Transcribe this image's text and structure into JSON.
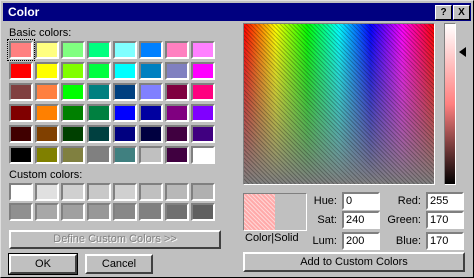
{
  "window": {
    "title": "Color",
    "help_btn": "?",
    "close_btn": "X"
  },
  "labels": {
    "basic_colors": "Basic colors:",
    "basic_colors_key": "B",
    "custom_colors": "Custom colors:",
    "custom_colors_key": "C"
  },
  "basic_colors": [
    "#ff8080",
    "#ffff80",
    "#80ff80",
    "#00ff80",
    "#80ffff",
    "#0080ff",
    "#ff80c0",
    "#ff80ff",
    "#ff0000",
    "#ffff00",
    "#80ff00",
    "#00ff40",
    "#00ffff",
    "#0080c0",
    "#8080c0",
    "#ff00ff",
    "#804040",
    "#ff8040",
    "#00ff00",
    "#008080",
    "#004080",
    "#8080ff",
    "#800040",
    "#ff0080",
    "#800000",
    "#ff8000",
    "#008000",
    "#008040",
    "#0000ff",
    "#0000a0",
    "#800080",
    "#8000ff",
    "#400000",
    "#804000",
    "#004000",
    "#004040",
    "#000080",
    "#000040",
    "#400040",
    "#400080",
    "#000000",
    "#808000",
    "#808040",
    "#808080",
    "#408080",
    "#c0c0c0",
    "#400040",
    "#ffffff"
  ],
  "custom_colors": [
    "#ffffff",
    "#e0e0e0",
    "#d0d0d0",
    "#c8c8c8",
    "#d0d0d0",
    "#c0c0c0",
    "#b8b8b8",
    "#b0b0b0",
    "#909090",
    "#a8a8a8",
    "#a0a0a0",
    "#989898",
    "#888888",
    "#808080",
    "#707070",
    "#606060"
  ],
  "buttons": {
    "define_custom": "Define Custom Colors >>",
    "ok": "OK",
    "cancel": "Cancel",
    "add_custom": "Add to Custom Colors"
  },
  "preview": {
    "label": "Color|Solid"
  },
  "fields": {
    "hue_label": "Hue:",
    "hue": "0",
    "sat_label": "Sat:",
    "sat": "240",
    "lum_label": "Lum:",
    "lum": "200",
    "red_label": "Red:",
    "red": "255",
    "green_label": "Green:",
    "green": "170",
    "blue_label": "Blue:",
    "blue": "170"
  }
}
